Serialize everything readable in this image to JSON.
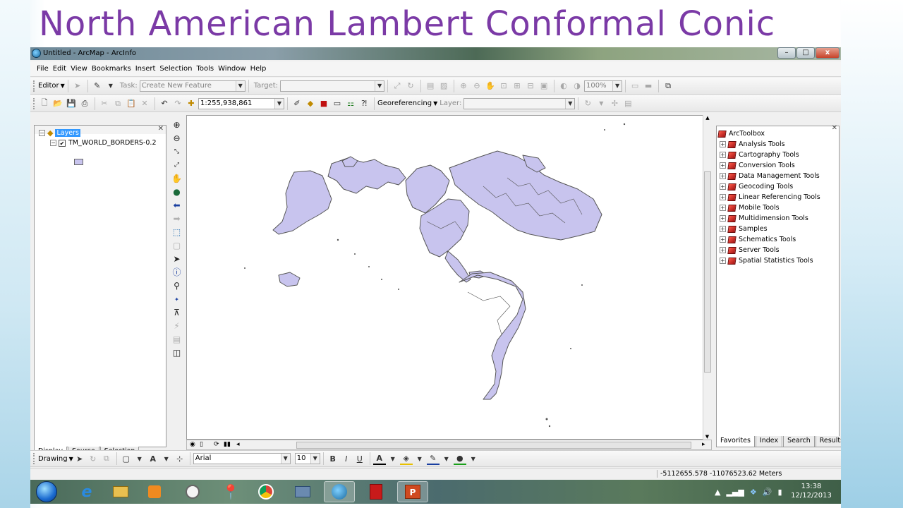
{
  "slide": {
    "title": "North American Lambert Conformal Conic"
  },
  "window": {
    "title": "Untitled - ArcMap - ArcInfo",
    "minimize": "–",
    "maximize": "□",
    "close": "x"
  },
  "menu": [
    "File",
    "Edit",
    "View",
    "Bookmarks",
    "Insert",
    "Selection",
    "Tools",
    "Window",
    "Help"
  ],
  "editor_toolbar": {
    "editor_label": "Editor",
    "task_label": "Task:",
    "task_value": "Create New Feature",
    "target_label": "Target:",
    "zoom_value": "100%"
  },
  "standard_toolbar": {
    "scale_value": "1:255,938,861",
    "georef_label": "Georeferencing",
    "layer_label": "Layer:"
  },
  "toc": {
    "root": "Layers",
    "layer": "TM_WORLD_BORDERS-0.2",
    "tabs": [
      "Display",
      "Source",
      "Selection"
    ]
  },
  "arctoolbox": {
    "root": "ArcToolbox",
    "items": [
      "Analysis Tools",
      "Cartography Tools",
      "Conversion Tools",
      "Data Management Tools",
      "Geocoding Tools",
      "Linear Referencing Tools",
      "Mobile Tools",
      "Multidimension Tools",
      "Samples",
      "Schematics Tools",
      "Server Tools",
      "Spatial Statistics Tools"
    ],
    "tabs": [
      "Favorites",
      "Index",
      "Search",
      "Results"
    ]
  },
  "drawing_toolbar": {
    "drawing_label": "Drawing",
    "font_value": "Arial",
    "size_value": "10",
    "bold": "B",
    "italic": "I",
    "underline": "U"
  },
  "status": {
    "coords": "-5112655.578  -11076523.62 Meters"
  },
  "taskbar": {
    "time": "13:38",
    "date": "12/12/2013"
  },
  "colors": {
    "title": "#7b3aa6",
    "land_fill": "#c8c4ee",
    "land_stroke": "#555555",
    "selection": "#3399ff"
  }
}
